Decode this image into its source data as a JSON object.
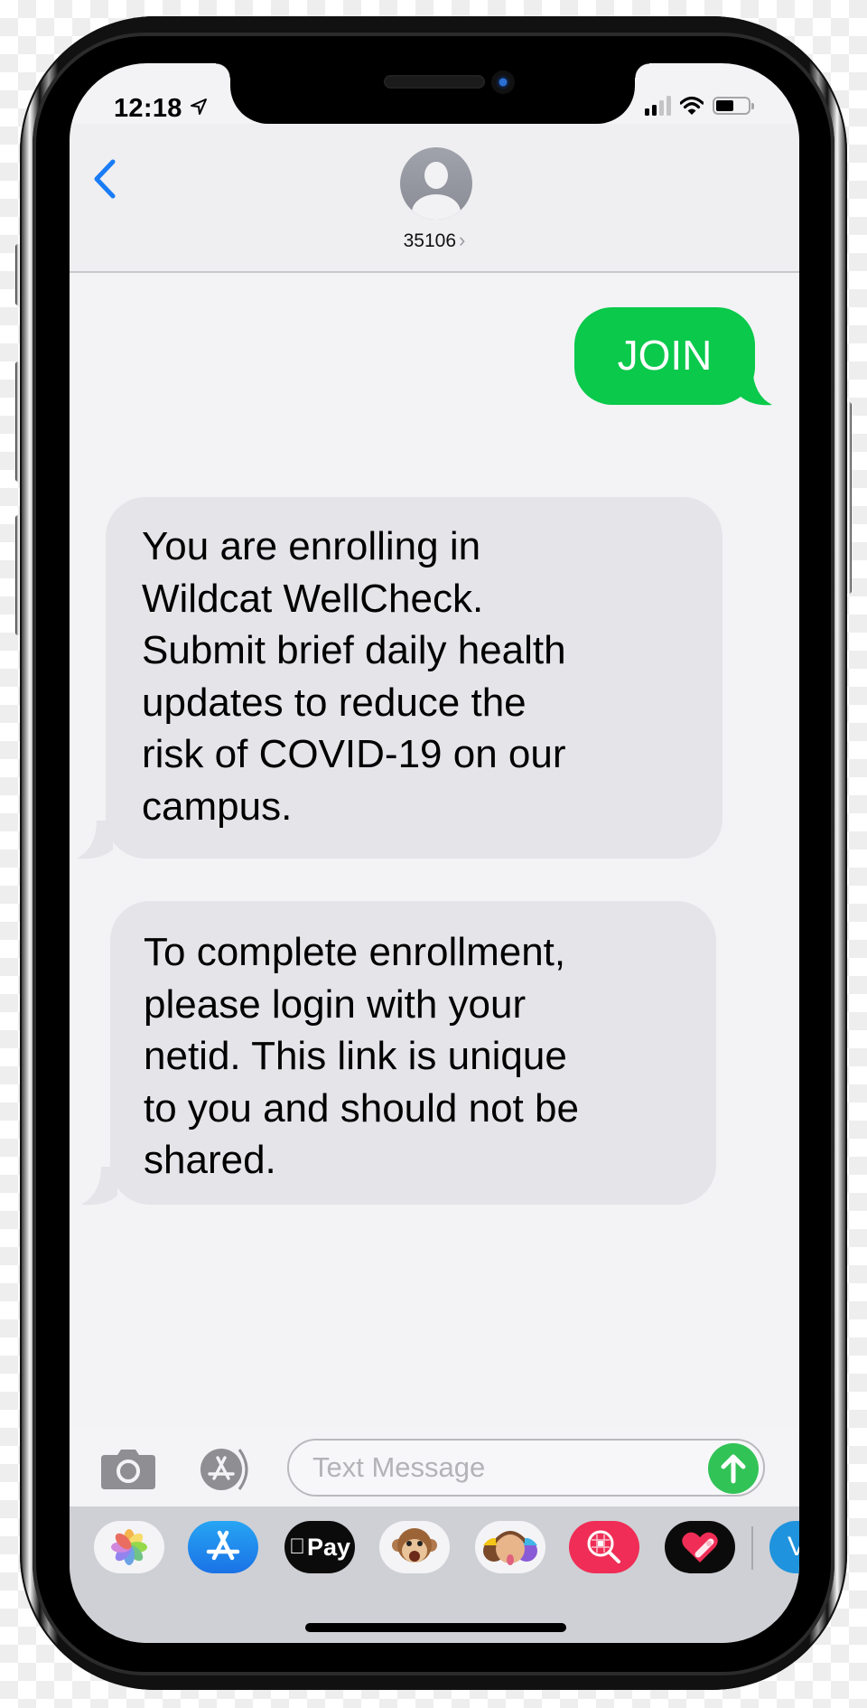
{
  "status_bar": {
    "time": "12:18",
    "location_icon": "location-arrow-icon",
    "signal_bars_active": 2,
    "signal_bars_total": 4,
    "wifi_icon": "wifi-icon",
    "battery_level": 0.55
  },
  "header": {
    "back_icon": "chevron-left-icon",
    "avatar_icon": "person-avatar-icon",
    "contact_name": "35106",
    "contact_chevron": "›"
  },
  "messages": [
    {
      "direction": "outgoing",
      "text": "JOIN"
    },
    {
      "direction": "incoming",
      "text": "You are enrolling in\nWildcat WellCheck.\nSubmit brief daily health\nupdates to reduce the\nrisk of COVID-19 on our\ncampus."
    },
    {
      "direction": "incoming",
      "text": "To complete enrollment,\nplease login with your\nnetid. This link is unique\nto you and should not be\nshared."
    }
  ],
  "compose": {
    "camera_icon": "camera-icon",
    "apps_icon": "app-store-icon",
    "placeholder": "Text Message",
    "value": "",
    "send_icon": "arrow-up-icon"
  },
  "app_drawer": {
    "items": [
      {
        "name": "Photos",
        "icon": "photos-icon"
      },
      {
        "name": "App Store",
        "icon": "app-store-icon"
      },
      {
        "name": "Apple Pay",
        "label": "Pay",
        "icon": "apple-pay-icon"
      },
      {
        "name": "Animoji",
        "icon": "monkey-animoji-icon"
      },
      {
        "name": "Memoji Stickers",
        "icon": "memoji-icon"
      },
      {
        "name": "#images",
        "icon": "image-search-icon"
      },
      {
        "name": "Digital Touch",
        "icon": "heart-touch-icon"
      },
      {
        "name": "Venmo",
        "label": "V",
        "icon": "venmo-icon"
      }
    ]
  },
  "colors": {
    "outgoing_bubble": "#0ac94b",
    "incoming_bubble": "#e4e4e9",
    "accent_blue": "#1a7cf5",
    "send_button": "#32c357"
  }
}
